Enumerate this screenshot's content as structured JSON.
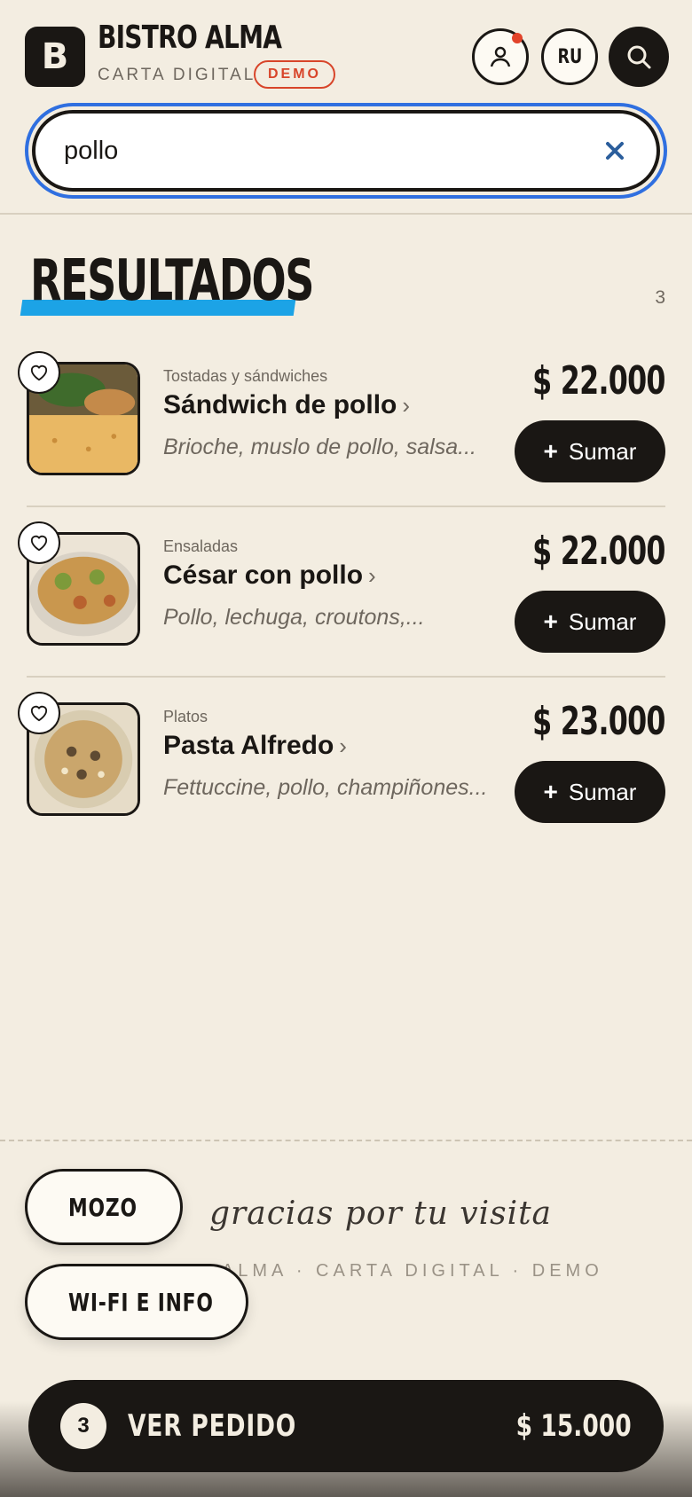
{
  "header": {
    "logo_letter": "B",
    "brand_name": "BISTRO ALMA",
    "brand_sub": "CARTA DIGITAL",
    "demo_badge": "DEMO",
    "lang": "RU",
    "icons": {
      "user": "user-icon",
      "search": "search-icon",
      "notification": "notification-dot"
    }
  },
  "search": {
    "value": "pollo",
    "clear_icon": "close-icon"
  },
  "results": {
    "title": "RESULTADOS",
    "count": "3",
    "items": [
      {
        "category": "Tostadas y sándwiches",
        "name": "Sándwich de pollo",
        "description": "Brioche, muslo de pollo, salsa...",
        "price": "$ 22.000",
        "add_label": "Sumar"
      },
      {
        "category": "Ensaladas",
        "name": "César con pollo",
        "description": "Pollo, lechuga, croutons,...",
        "price": "$ 22.000",
        "add_label": "Sumar"
      },
      {
        "category": "Platos",
        "name": "Pasta Alfredo",
        "description": "Fettuccine, pollo, champiñones...",
        "price": "$ 23.000",
        "add_label": "Sumar"
      }
    ]
  },
  "footer": {
    "thanks": "gracias por tu visita",
    "sub": "BISTRO ALMA · CARTA DIGITAL · DEMO"
  },
  "floating": {
    "mozo": "MOZO",
    "wifi": "WI-FI E INFO"
  },
  "order_bar": {
    "count": "3",
    "label": "VER PEDIDO",
    "total": "$ 15.000"
  },
  "colors": {
    "background": "#f3ede1",
    "ink": "#1a1714",
    "accent_blue": "#1ca3e6",
    "focus_ring": "#2f6fe0",
    "demo_red": "#d8452a"
  }
}
